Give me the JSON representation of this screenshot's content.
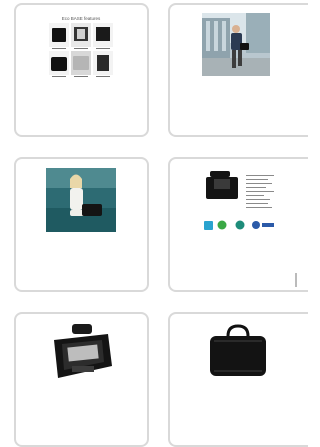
{
  "gallery": {
    "products": [
      {
        "name": "eco-base-features-collage",
        "title": "Eco BASE features",
        "caption_labels": [
          "",
          "",
          "",
          "",
          "",
          ""
        ]
      },
      {
        "name": "man-walking-with-bag-photo"
      },
      {
        "name": "woman-sitting-with-bag-photo"
      },
      {
        "name": "bag-with-eco-features-list-photo"
      },
      {
        "name": "open-bag-interior-photo"
      },
      {
        "name": "closed-black-bag-photo"
      }
    ]
  }
}
